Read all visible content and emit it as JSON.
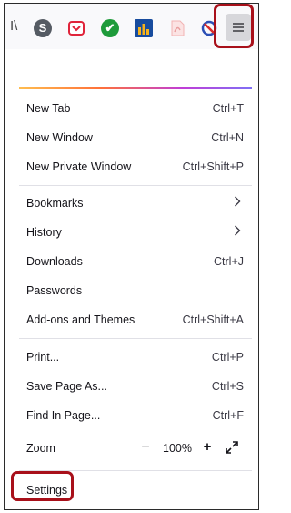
{
  "toolbar": {
    "overflow_text": "I\\",
    "icons": [
      {
        "name": "s-extension-icon",
        "glyph": "S"
      },
      {
        "name": "pocket-icon"
      },
      {
        "name": "checkmark-extension-icon",
        "glyph": "✔"
      },
      {
        "name": "bar-chart-extension-icon"
      },
      {
        "name": "pdf-icon"
      },
      {
        "name": "blocker-icon"
      }
    ],
    "menu_icon": "hamburger-menu-icon"
  },
  "menu": {
    "group1": [
      {
        "label": "New Tab",
        "shortcut": "Ctrl+T"
      },
      {
        "label": "New Window",
        "shortcut": "Ctrl+N"
      },
      {
        "label": "New Private Window",
        "shortcut": "Ctrl+Shift+P"
      }
    ],
    "group2": [
      {
        "label": "Bookmarks"
      },
      {
        "label": "History"
      },
      {
        "label": "Downloads",
        "shortcut": "Ctrl+J"
      },
      {
        "label": "Passwords"
      },
      {
        "label": "Add-ons and Themes",
        "shortcut": "Ctrl+Shift+A"
      }
    ],
    "group3": [
      {
        "label": "Print...",
        "shortcut": "Ctrl+P"
      },
      {
        "label": "Save Page As...",
        "shortcut": "Ctrl+S"
      },
      {
        "label": "Find In Page...",
        "shortcut": "Ctrl+F"
      }
    ],
    "zoom": {
      "label": "Zoom",
      "minus": "−",
      "value": "100%",
      "plus": "+"
    },
    "settings": {
      "label": "Settings"
    }
  },
  "colors": {
    "highlight": "#a8101a",
    "accent_gradient": [
      "#ffbd4f",
      "#ff7139",
      "#c03dd7",
      "#7f6ff5"
    ]
  }
}
